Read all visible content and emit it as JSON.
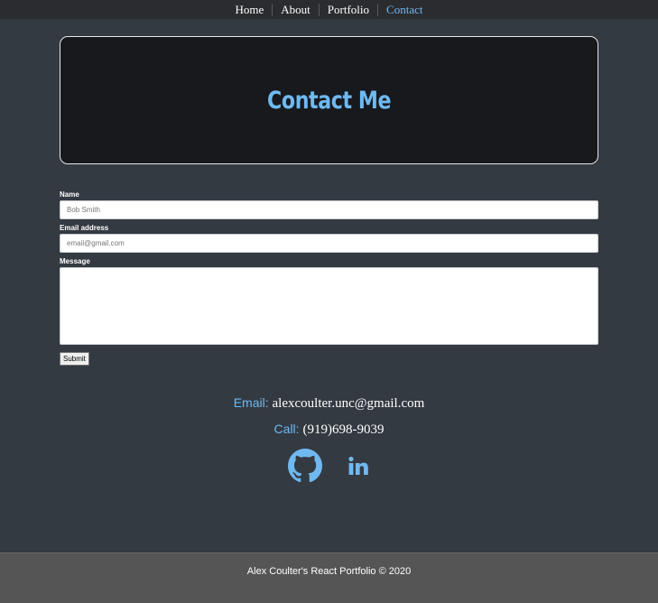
{
  "nav": {
    "items": [
      {
        "label": "Home"
      },
      {
        "label": "About"
      },
      {
        "label": "Portfolio"
      },
      {
        "label": "Contact"
      }
    ],
    "active": "Contact"
  },
  "hero": {
    "title": "Contact Me"
  },
  "form": {
    "name_label": "Name",
    "name_placeholder": "Bob Smith",
    "email_label": "Email address",
    "email_placeholder": "email@gmail.com",
    "message_label": "Message",
    "submit_label": "Submit"
  },
  "contact": {
    "email_key": "Email:",
    "email_value": "alexcoulter.unc@gmail.com",
    "call_key": "Call:",
    "call_value": "(919)698-9039"
  },
  "social": {
    "icons": [
      "github-icon",
      "linkedin-icon"
    ]
  },
  "footer": {
    "text": "Alex Coulter's React Portfolio © 2020"
  },
  "colors": {
    "accent": "#6fb9f0",
    "background": "#343a42",
    "navbar": "#2a2c2f",
    "hero_bg": "#17191d",
    "footer_bg": "#555556"
  }
}
